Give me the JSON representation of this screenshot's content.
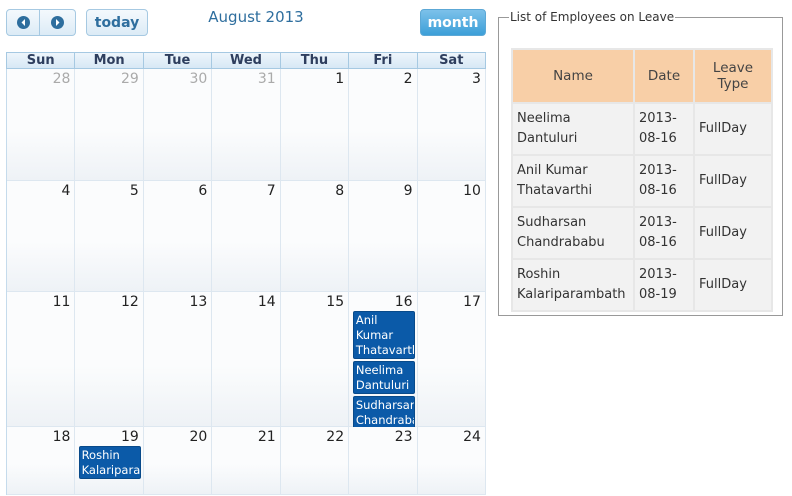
{
  "toolbar": {
    "today_label": "today",
    "month_label": "month",
    "title": "August 2013"
  },
  "weekdays": [
    "Sun",
    "Mon",
    "Tue",
    "Wed",
    "Thu",
    "Fri",
    "Sat"
  ],
  "weeks": [
    {
      "days": [
        "28",
        "29",
        "30",
        "31",
        "1",
        "2",
        "3"
      ],
      "other": [
        true,
        true,
        true,
        true,
        false,
        false,
        false
      ]
    },
    {
      "days": [
        "4",
        "5",
        "6",
        "7",
        "8",
        "9",
        "10"
      ],
      "other": [
        false,
        false,
        false,
        false,
        false,
        false,
        false
      ]
    },
    {
      "days": [
        "11",
        "12",
        "13",
        "14",
        "15",
        "16",
        "17"
      ],
      "other": [
        false,
        false,
        false,
        false,
        false,
        false,
        false
      ]
    },
    {
      "days": [
        "18",
        "19",
        "20",
        "21",
        "22",
        "23",
        "24"
      ],
      "other": [
        false,
        false,
        false,
        false,
        false,
        false,
        false
      ]
    }
  ],
  "events": [
    {
      "week": 2,
      "col": 5,
      "slot": 0,
      "lines": 3,
      "title": "Anil\nKumar\nThatavarthi"
    },
    {
      "week": 2,
      "col": 5,
      "slot": 1,
      "lines": 2,
      "title": "Neelima\nDantuluri"
    },
    {
      "week": 2,
      "col": 5,
      "slot": 2,
      "lines": 2,
      "title": "Sudharsan\nChandrababu"
    },
    {
      "week": 3,
      "col": 1,
      "slot": 0,
      "lines": 2,
      "title": "Roshin\nKalariparambath"
    }
  ],
  "leave_panel": {
    "legend": "List of Employees on Leave",
    "headers": [
      "Name",
      "Date",
      "Leave\nType"
    ],
    "rows": [
      [
        "Neelima Dantuluri",
        "2013-\n08-16",
        "FullDay"
      ],
      [
        "Anil Kumar\nThatavarthi",
        "2013-\n08-16",
        "FullDay"
      ],
      [
        "Sudharsan\nChandrababu",
        "2013-\n08-16",
        "FullDay"
      ],
      [
        "Roshin\nKalariparambath",
        "2013-\n08-19",
        "FullDay"
      ]
    ]
  }
}
